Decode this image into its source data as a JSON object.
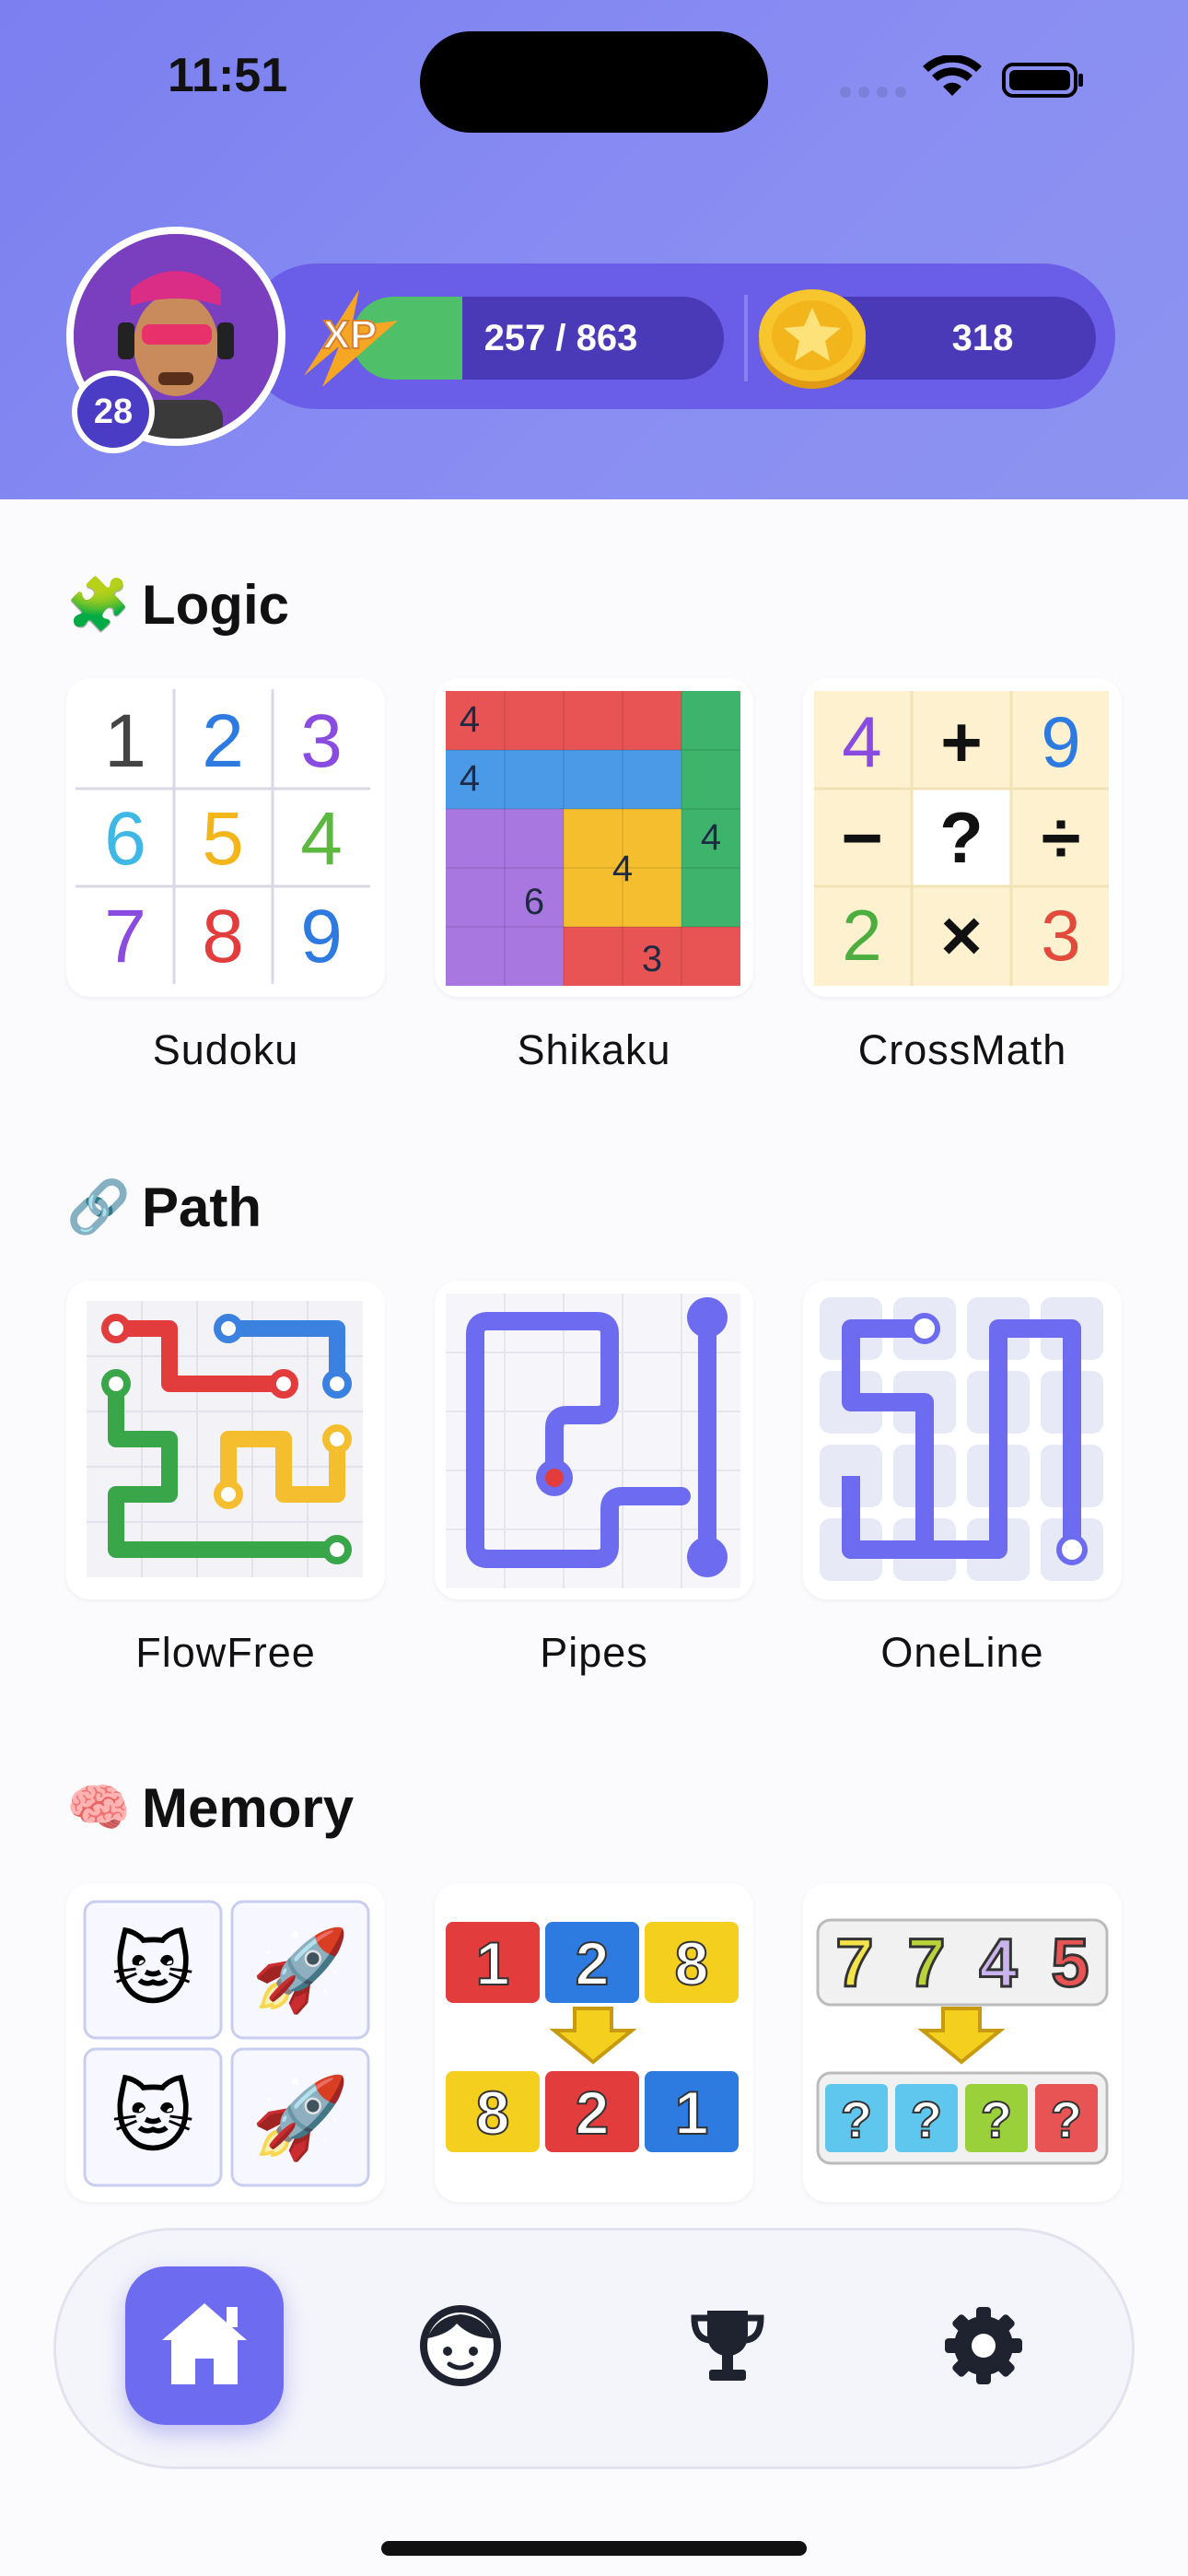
{
  "status_bar": {
    "time": "11:51"
  },
  "player": {
    "level": "28",
    "xp_label": "XP",
    "xp_text": "257 / 863",
    "xp_progress": 0.298,
    "coins": "318"
  },
  "sections": [
    {
      "emoji": "🧩",
      "title": "Logic",
      "games": [
        "Sudoku",
        "Shikaku",
        "CrossMath"
      ]
    },
    {
      "emoji": "🔗",
      "title": "Path",
      "games": [
        "FlowFree",
        "Pipes",
        "OneLine"
      ]
    },
    {
      "emoji": "🧠",
      "title": "Memory",
      "games": [
        "",
        "",
        ""
      ]
    }
  ],
  "thumbs": {
    "sudoku": [
      "1",
      "2",
      "3",
      "6",
      "5",
      "4",
      "7",
      "8",
      "9"
    ],
    "shikaku": [
      "4",
      "4",
      "4",
      "4",
      "6",
      "3"
    ],
    "crossmath": [
      "4",
      "+",
      "9",
      "−",
      "?",
      "÷",
      "2",
      "×",
      "3"
    ],
    "memory_emoji": [
      "🐱",
      "🚀",
      "🐱",
      "🚀"
    ],
    "memory_numbers_top": [
      "1",
      "2",
      "8"
    ],
    "memory_numbers_bottom": [
      "8",
      "2",
      "1"
    ],
    "memory_digits_top": [
      "7",
      "7",
      "4",
      "5"
    ],
    "memory_digits_bottom": [
      "?",
      "?",
      "?",
      "?"
    ]
  },
  "nav": {
    "items": [
      "home",
      "profile",
      "leaderboard",
      "settings"
    ]
  },
  "colors": {
    "accent": "#6d6cf0",
    "header": "#8a8ef2",
    "xp_green": "#4fbf6a",
    "pill": "#4a3ab8"
  }
}
